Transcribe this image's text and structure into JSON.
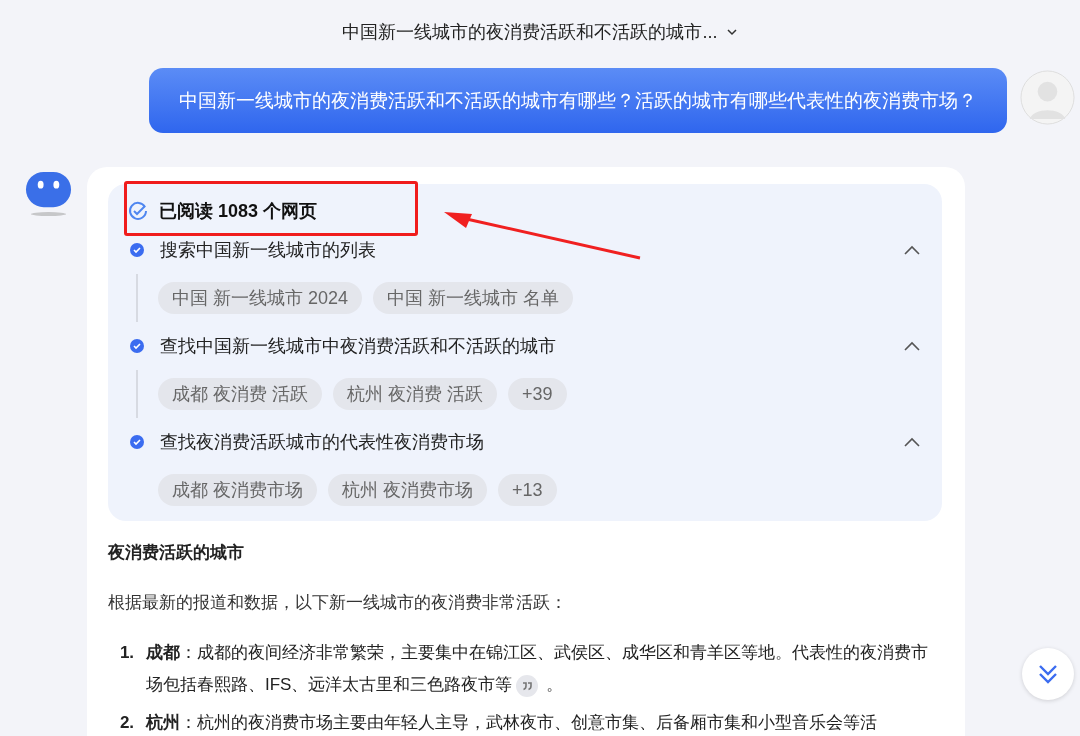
{
  "header": {
    "title": "中国新一线城市的夜消费活跃和不活跃的城市..."
  },
  "user_message": {
    "text": "中国新一线城市的夜消费活跃和不活跃的城市有哪些？活跃的城市有哪些代表性的夜消费市场？"
  },
  "research": {
    "summary": "已阅读 1083 个网页",
    "steps": [
      {
        "title": "搜索中国新一线城市的列表",
        "done": true,
        "expanded": true,
        "queries": [
          "中国 新一线城市 2024",
          "中国 新一线城市 名单"
        ]
      },
      {
        "title": "查找中国新一线城市中夜消费活跃和不活跃的城市",
        "done": true,
        "expanded": true,
        "queries": [
          "成都 夜消费 活跃",
          "杭州 夜消费 活跃",
          "+39"
        ]
      },
      {
        "title": "查找夜消费活跃城市的代表性夜消费市场",
        "done": true,
        "expanded": true,
        "queries": [
          "成都 夜消费市场",
          "杭州 夜消费市场",
          "+13"
        ]
      }
    ]
  },
  "answer": {
    "heading": "夜消费活跃的城市",
    "intro": "根据最新的报道和数据，以下新一线城市的夜消费非常活跃：",
    "items": [
      {
        "number": "1.",
        "text": "**成都**：成都的夜间经济非常繁荣，主要集中在锦江区、武侯区、成华区和青羊区等地。代表性的夜消费市场包括春熙路、IFS、远洋太古里和三色路夜市等",
        "citation": true,
        "tail": "。"
      },
      {
        "number": "2.",
        "text": "**杭州**：杭州的夜消费市场主要由年轻人主导，武林夜市、创意市集、后备厢市集和小型音乐会等活"
      }
    ]
  }
}
